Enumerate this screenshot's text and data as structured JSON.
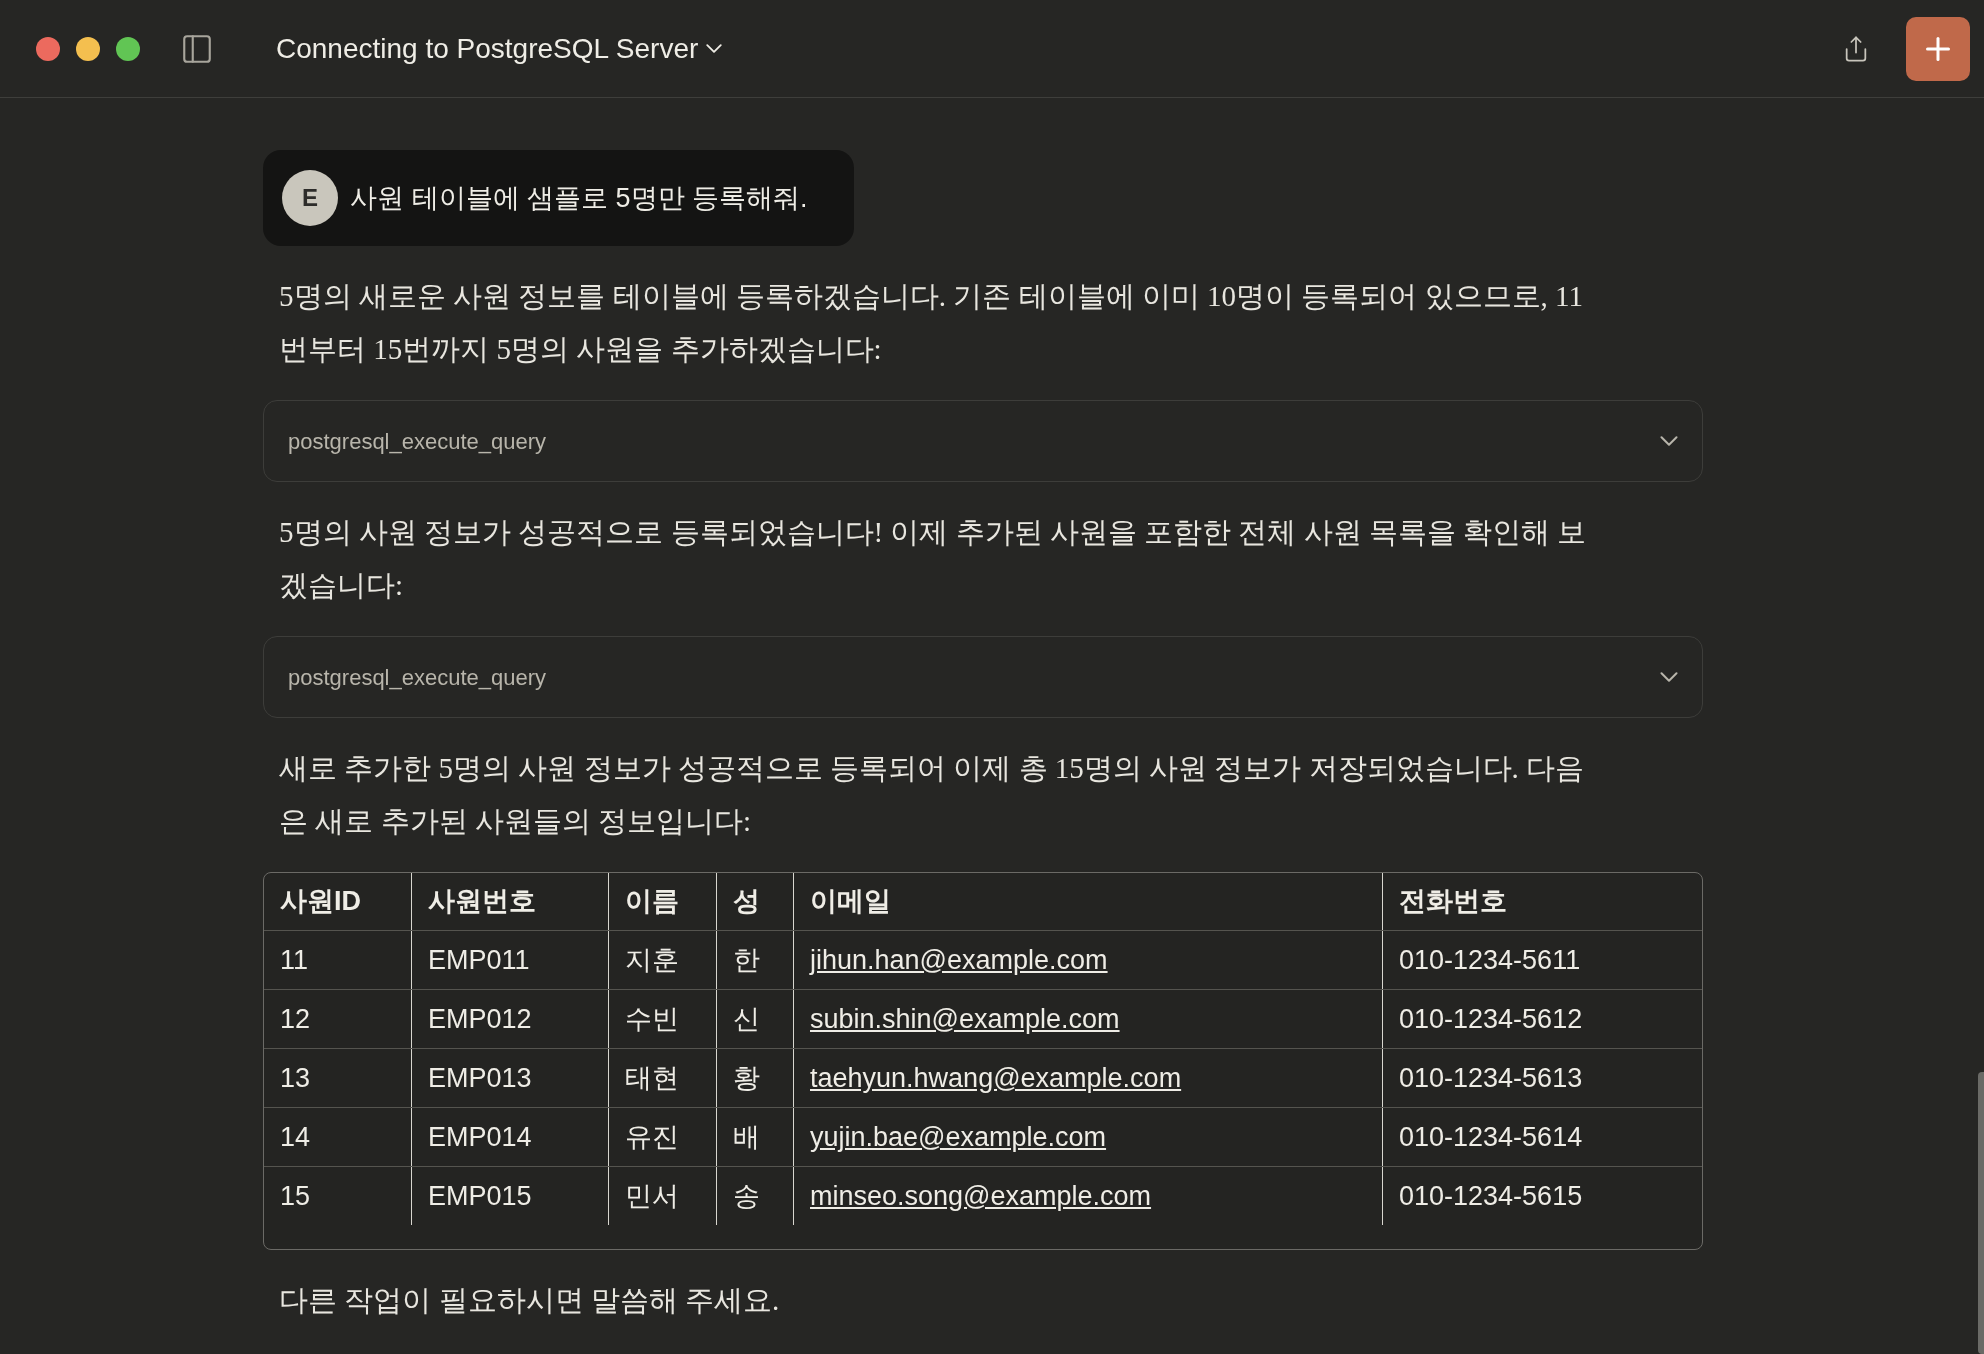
{
  "window": {
    "title": "Connecting to PostgreSQL Server"
  },
  "user_message": {
    "avatar": "E",
    "text": "사원 테이블에 샘플로 5명만 등록해줘."
  },
  "messages": [
    {
      "kind": "text",
      "text": "5명의 새로운 사원 정보를 테이블에 등록하겠습니다. 기존 테이블에 이미 10명이 등록되어 있으므로, 11번부터 15번까지 5명의 사원을 추가하겠습니다:"
    },
    {
      "kind": "tool",
      "text": "postgresql_execute_query",
      "expanded": false
    },
    {
      "kind": "text",
      "text": "5명의 사원 정보가 성공적으로 등록되었습니다! 이제 추가된 사원을 포함한 전체 사원 목록을 확인해 보겠습니다:"
    },
    {
      "kind": "tool",
      "text": "postgresql_execute_query",
      "expanded": false
    },
    {
      "kind": "text",
      "text": "새로 추가한 5명의 사원 정보가 성공적으로 등록되어 이제 총 15명의 사원 정보가 저장되었습니다. 다음은 새로 추가된 사원들의 정보입니다:"
    },
    {
      "kind": "table",
      "columns": [
        "사원ID",
        "사원번호",
        "이름",
        "성",
        "이메일",
        "전화번호"
      ],
      "rows": [
        [
          "11",
          "EMP011",
          "지훈",
          "한",
          "jihun.han@example.com",
          "010-1234-5611"
        ],
        [
          "12",
          "EMP012",
          "수빈",
          "신",
          "subin.shin@example.com",
          "010-1234-5612"
        ],
        [
          "13",
          "EMP013",
          "태현",
          "황",
          "taehyun.hwang@example.com",
          "010-1234-5613"
        ],
        [
          "14",
          "EMP014",
          "유진",
          "배",
          "yujin.bae@example.com",
          "010-1234-5614"
        ],
        [
          "15",
          "EMP015",
          "민서",
          "송",
          "minseo.song@example.com",
          "010-1234-5615"
        ]
      ]
    },
    {
      "kind": "text",
      "text": "다른 작업이 필요하시면 말씀해 주세요."
    }
  ]
}
